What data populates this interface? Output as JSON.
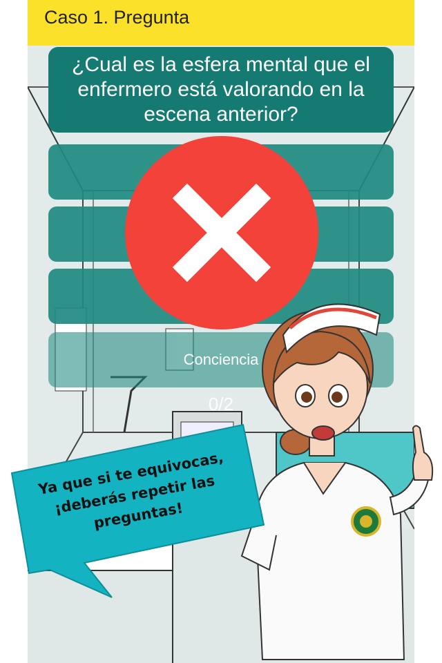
{
  "header": {
    "title": "Caso 1. Pregunta"
  },
  "question": {
    "text": "¿Cual es la esfera mental que el enfermero está valorando en la escena anterior?"
  },
  "options": [
    {
      "label": ""
    },
    {
      "label": ""
    },
    {
      "label": ""
    },
    {
      "label": "Conciencia"
    }
  ],
  "progress": {
    "text": "0/2"
  },
  "feedback": {
    "icon": "wrong-cross-icon",
    "color": "#f2423a"
  },
  "tip": {
    "text": "Ya que si te equivocas, ¡deberás repetir las preguntas!"
  },
  "colors": {
    "header": "#fbe12a",
    "question_bg": "#157a72",
    "option_bg": "#1f8a80",
    "bubble": "#14b3c2"
  }
}
